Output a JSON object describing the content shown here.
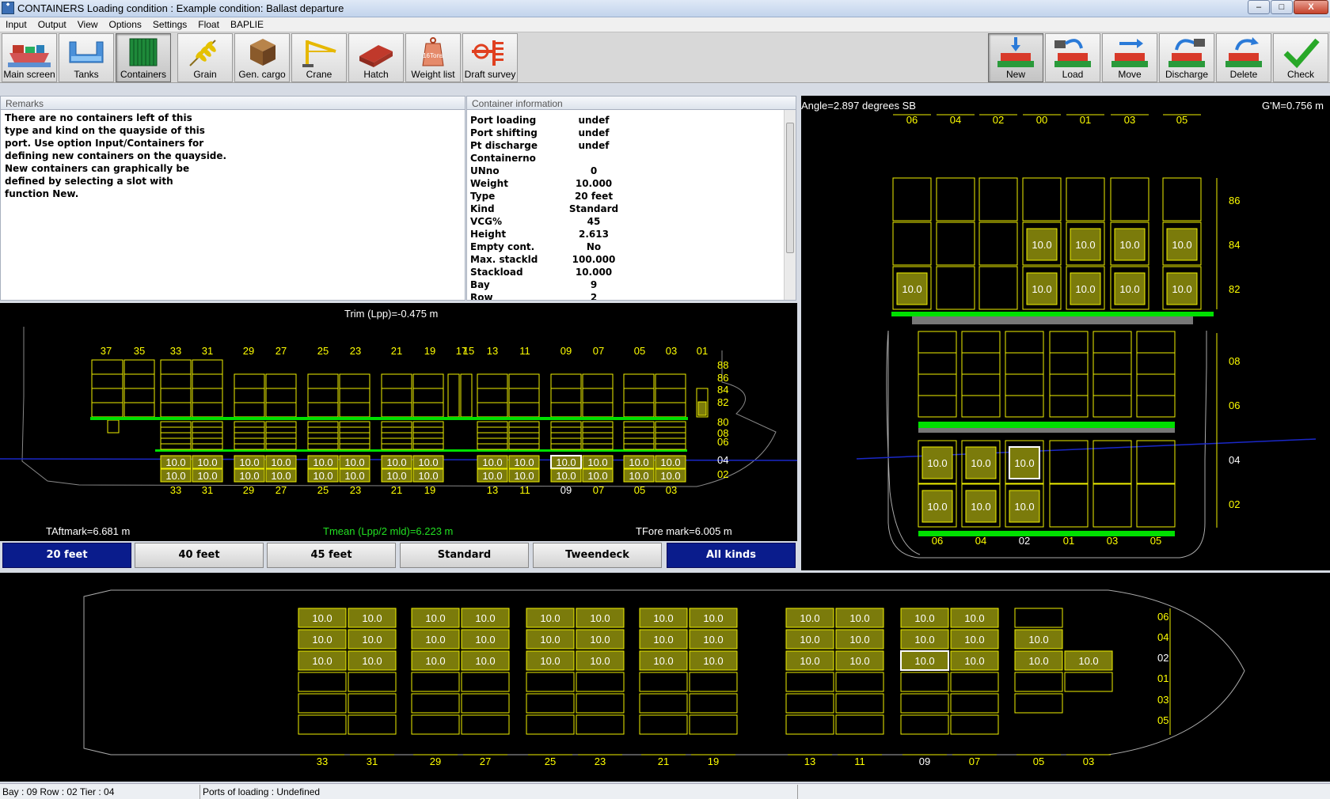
{
  "window": {
    "title": "CONTAINERS  Loading condition : Example condition: Ballast departure",
    "icon": "app-icon",
    "min": "–",
    "max": "□",
    "close": "X"
  },
  "menu": [
    "Input",
    "Output",
    "View",
    "Options",
    "Settings",
    "Float",
    "BAPLIE"
  ],
  "toolbar_left": [
    {
      "label": "Main screen",
      "icon": "ship-icon"
    },
    {
      "label": "Tanks",
      "icon": "tanks-icon"
    },
    {
      "label": "Containers",
      "icon": "container-icon",
      "active": true
    },
    {
      "label": "Grain",
      "icon": "grain-icon"
    },
    {
      "label": "Gen. cargo",
      "icon": "cargo-box-icon"
    },
    {
      "label": "Crane",
      "icon": "crane-icon"
    },
    {
      "label": "Hatch",
      "icon": "hatch-icon"
    },
    {
      "label": "Weight list",
      "icon": "weight-icon",
      "icon_text": "16Tons"
    },
    {
      "label": "Draft survey",
      "icon": "draft-survey-icon"
    }
  ],
  "toolbar_right": [
    {
      "label": "New",
      "icon": "new-icon",
      "active": true
    },
    {
      "label": "Load",
      "icon": "load-icon"
    },
    {
      "label": "Move",
      "icon": "move-icon"
    },
    {
      "label": "Discharge",
      "icon": "discharge-icon"
    },
    {
      "label": "Delete",
      "icon": "delete-icon"
    },
    {
      "label": "Check",
      "icon": "checkmark-icon"
    }
  ],
  "remarks": {
    "title": "Remarks",
    "text": "There are no containers left of this\ntype and kind on the quayside of this\nport. Use option Input/Containers for\ndefining new containers on the quayside.\nNew containers can graphically be\ndefined by selecting a slot with\nfunction New."
  },
  "container_info": {
    "title": "Container information",
    "rows": [
      {
        "k": "Port loading",
        "v": "undef"
      },
      {
        "k": "Port shifting",
        "v": "undef"
      },
      {
        "k": "Pt discharge",
        "v": "undef"
      },
      {
        "k": "Containerno",
        "v": ""
      },
      {
        "k": "UNno",
        "v": "0"
      },
      {
        "k": "Weight",
        "v": "10.000"
      },
      {
        "k": "Type",
        "v": "20 feet"
      },
      {
        "k": "Kind",
        "v": "Standard"
      },
      {
        "k": "VCG%",
        "v": "45"
      },
      {
        "k": "Height",
        "v": "2.613"
      },
      {
        "k": "Empty cont.",
        "v": "No"
      },
      {
        "k": "Max. stackld",
        "v": "100.000"
      },
      {
        "k": "Stackload",
        "v": "10.000"
      },
      {
        "k": "Bay",
        "v": "9"
      },
      {
        "k": "Row",
        "v": "2"
      }
    ]
  },
  "profile": {
    "trim": "Trim (Lpp)=-0.475 m",
    "taft": "TAftmark=6.681 m",
    "tmean": "Tmean (Lpp/2 mld)=6.223 m",
    "tfore": "TFore mark=6.005 m",
    "top_bays": [
      "37",
      "35",
      "33",
      "31",
      "29",
      "27",
      "25",
      "23",
      "21",
      "19",
      "17",
      "15",
      "13",
      "11",
      "09",
      "07",
      "05",
      "03",
      "01"
    ],
    "bottom_bays": [
      "33",
      "31",
      "29",
      "27",
      "25",
      "23",
      "21",
      "19",
      "13",
      "11",
      "09",
      "07",
      "05",
      "03"
    ],
    "tiers": [
      "88",
      "86",
      "84",
      "82",
      "80",
      "08",
      "06",
      "04",
      "02"
    ],
    "weight_label": "10.0"
  },
  "bayview": {
    "angle": "Angle=2.897 degrees SB",
    "gm": "G'M=0.756 m",
    "rows_top": [
      "06",
      "04",
      "02",
      "00",
      "01",
      "03",
      "05"
    ],
    "rows_bottom": [
      "06",
      "04",
      "02",
      "01",
      "03",
      "05"
    ],
    "tiers_top": [
      "86",
      "84",
      "82"
    ],
    "tiers_bottom": [
      "08",
      "06",
      "04",
      "02"
    ],
    "weight_label": "10.0"
  },
  "filters": [
    {
      "label": "20 feet",
      "selected": true
    },
    {
      "label": "40 feet",
      "selected": false
    },
    {
      "label": "45 feet",
      "selected": false
    },
    {
      "label": "Standard",
      "selected": false
    },
    {
      "label": "Tweendeck",
      "selected": false
    },
    {
      "label": "All kinds",
      "selected": true
    }
  ],
  "plan": {
    "bays": [
      "33",
      "31",
      "29",
      "27",
      "25",
      "23",
      "21",
      "19",
      "13",
      "11",
      "09",
      "07",
      "05",
      "03"
    ],
    "rows": [
      "06",
      "04",
      "02",
      "01",
      "03",
      "05"
    ],
    "weight_label": "10.0"
  },
  "status": {
    "position": "Bay : 09   Row : 02   Tier : 04",
    "ports": "Ports of loading :  Undefined"
  },
  "colors": {
    "container_fill": "#7b7b0b",
    "slot_line": "#f0f000",
    "hatch_green": "#00e000",
    "waterline": "#1a28c8",
    "selected": "#ffffff"
  }
}
